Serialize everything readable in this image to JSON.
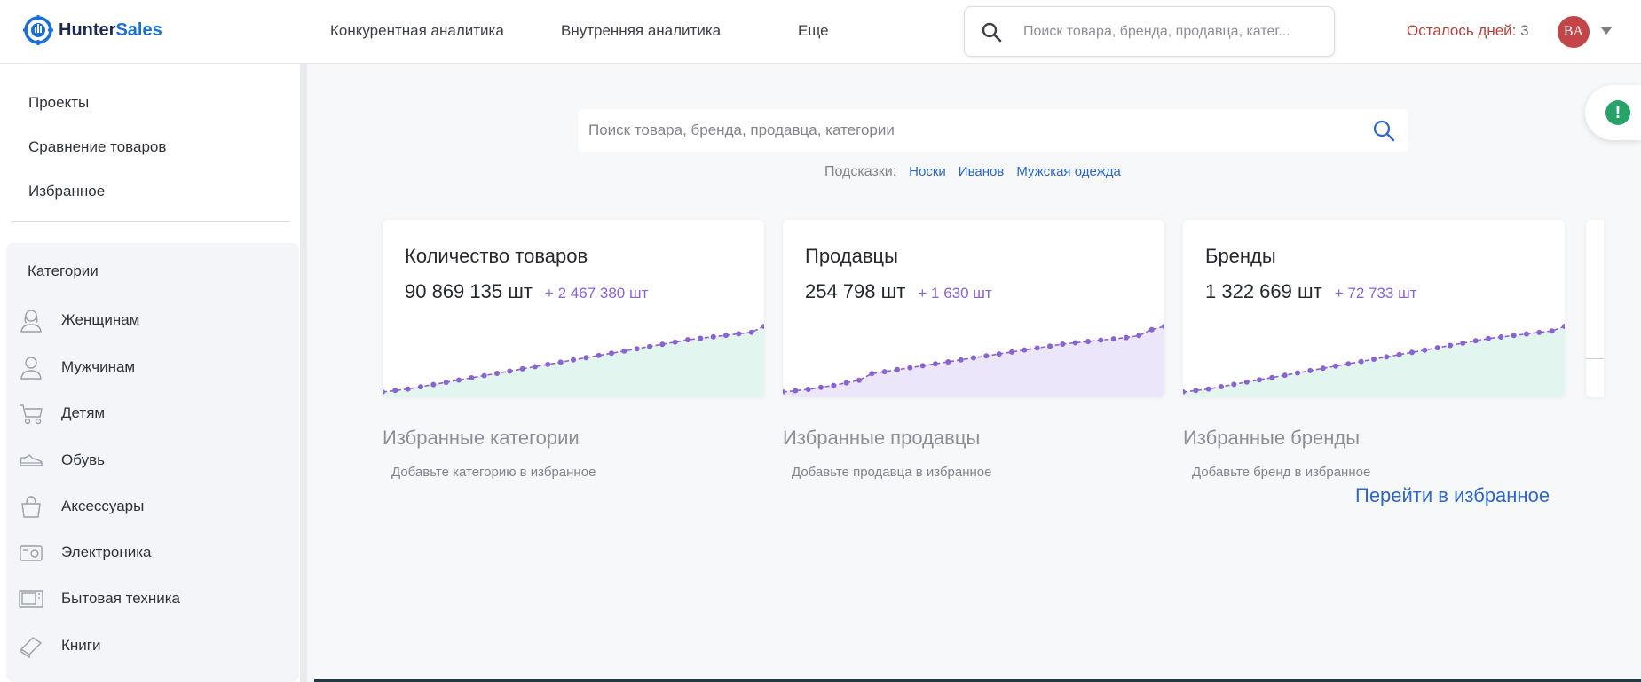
{
  "header": {
    "logo_text_main": "Hunter",
    "logo_text_accent": "Sales",
    "nav": [
      "Конкурентная аналитика",
      "Внутренняя аналитика",
      "Еще"
    ],
    "search_placeholder": "Поиск товара, бренда, продавца, катег...",
    "days_left_label": "Осталось дней:",
    "days_left_value": "3",
    "avatar_initials": "BA"
  },
  "sidebar": {
    "links": [
      "Проекты",
      "Сравнение товаров",
      "Избранное"
    ],
    "categories_title": "Категории",
    "categories": [
      {
        "label": "Женщинам",
        "icon": "woman-icon"
      },
      {
        "label": "Мужчинам",
        "icon": "man-icon"
      },
      {
        "label": "Детям",
        "icon": "stroller-icon"
      },
      {
        "label": "Обувь",
        "icon": "shoe-icon"
      },
      {
        "label": "Аксессуары",
        "icon": "bag-icon"
      },
      {
        "label": "Электроника",
        "icon": "camera-icon"
      },
      {
        "label": "Бытовая техника",
        "icon": "microwave-icon"
      },
      {
        "label": "Книги",
        "icon": "book-icon"
      }
    ]
  },
  "main": {
    "search_placeholder": "Поиск товара, бренда, продавца, категории",
    "hints_label": "Подсказки:",
    "hints": [
      "Носки",
      "Иванов",
      "Мужская одежда"
    ],
    "cards": [
      {
        "title": "Количество товаров",
        "value": "90 869 135 шт",
        "delta": "+ 2 467 380 шт",
        "fill": "#e3f5ef",
        "trend": [
          0,
          2,
          4,
          7,
          10,
          13,
          16,
          19,
          22,
          25,
          28,
          31,
          34,
          37,
          40,
          43,
          46,
          49,
          52,
          55,
          58,
          61,
          64,
          67,
          70,
          72,
          74,
          76,
          78,
          80,
          88
        ]
      },
      {
        "title": "Продавцы",
        "value": "254 798 шт",
        "delta": "+ 1 630 шт",
        "fill": "#ece6fb",
        "trend": [
          0,
          2,
          4,
          7,
          10,
          14,
          18,
          28,
          31,
          34,
          37,
          40,
          43,
          46,
          49,
          52,
          55,
          58,
          61,
          64,
          67,
          70,
          73,
          75,
          77,
          79,
          81,
          83,
          86,
          95,
          100
        ]
      },
      {
        "title": "Бренды",
        "value": "1 322 669 шт",
        "delta": "+ 72 733 шт",
        "fill": "#e3f5ef",
        "trend": [
          0,
          2,
          4,
          7,
          10,
          13,
          16,
          19,
          22,
          25,
          28,
          31,
          34,
          37,
          40,
          43,
          46,
          49,
          52,
          55,
          58,
          61,
          64,
          67,
          70,
          72,
          74,
          76,
          78,
          80,
          86
        ]
      }
    ],
    "favorites": [
      {
        "title": "Избранные категории",
        "sub": "Добавьте категорию в избранное"
      },
      {
        "title": "Избранные продавцы",
        "sub": "Добавьте продавца в избранное"
      },
      {
        "title": "Избранные бренды",
        "sub": "Добавьте бренд в избранное"
      }
    ],
    "goto_favorites": "Перейти в избранное",
    "alert_icon_text": "!"
  },
  "colors": {
    "accent": "#2e67c7",
    "line": "#8a63d2",
    "days": "#b2433c",
    "avatar": "#c34548",
    "alert": "#27a36a"
  }
}
